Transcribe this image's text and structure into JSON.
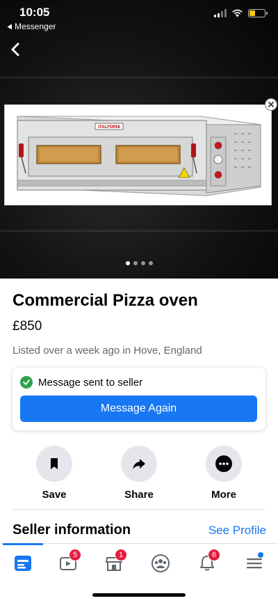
{
  "status_bar": {
    "time": "10:05",
    "back_app": "Messenger",
    "icons": [
      "signal-icon",
      "wifi-icon",
      "battery-icon"
    ]
  },
  "listing": {
    "title": "Commercial Pizza oven",
    "price": "£850",
    "listed": "Listed over a week ago in Hove, England",
    "image_brand": "ITALFORNI",
    "image_count": 4,
    "active_image_index": 0
  },
  "message_card": {
    "status": "Message sent to seller",
    "button_label": "Message Again"
  },
  "actions": {
    "save": "Save",
    "share": "Share",
    "more": "More"
  },
  "seller": {
    "heading": "Seller information",
    "link": "See Profile"
  },
  "tabbar": {
    "watch_badge": "5",
    "marketplace_badge": "1",
    "notifications_badge": "6"
  },
  "colors": {
    "accent": "#1877f2",
    "badge": "#e41e3f",
    "success": "#31a24c",
    "battery": "#f5c518"
  }
}
